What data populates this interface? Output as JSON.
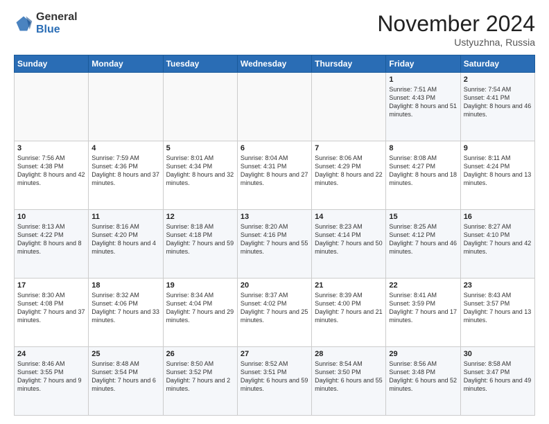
{
  "header": {
    "logo_general": "General",
    "logo_blue": "Blue",
    "month_title": "November 2024",
    "location": "Ustyuzhna, Russia"
  },
  "days_of_week": [
    "Sunday",
    "Monday",
    "Tuesday",
    "Wednesday",
    "Thursday",
    "Friday",
    "Saturday"
  ],
  "weeks": [
    [
      {
        "num": "",
        "info": ""
      },
      {
        "num": "",
        "info": ""
      },
      {
        "num": "",
        "info": ""
      },
      {
        "num": "",
        "info": ""
      },
      {
        "num": "",
        "info": ""
      },
      {
        "num": "1",
        "info": "Sunrise: 7:51 AM\nSunset: 4:43 PM\nDaylight: 8 hours\nand 51 minutes."
      },
      {
        "num": "2",
        "info": "Sunrise: 7:54 AM\nSunset: 4:41 PM\nDaylight: 8 hours\nand 46 minutes."
      }
    ],
    [
      {
        "num": "3",
        "info": "Sunrise: 7:56 AM\nSunset: 4:38 PM\nDaylight: 8 hours\nand 42 minutes."
      },
      {
        "num": "4",
        "info": "Sunrise: 7:59 AM\nSunset: 4:36 PM\nDaylight: 8 hours\nand 37 minutes."
      },
      {
        "num": "5",
        "info": "Sunrise: 8:01 AM\nSunset: 4:34 PM\nDaylight: 8 hours\nand 32 minutes."
      },
      {
        "num": "6",
        "info": "Sunrise: 8:04 AM\nSunset: 4:31 PM\nDaylight: 8 hours\nand 27 minutes."
      },
      {
        "num": "7",
        "info": "Sunrise: 8:06 AM\nSunset: 4:29 PM\nDaylight: 8 hours\nand 22 minutes."
      },
      {
        "num": "8",
        "info": "Sunrise: 8:08 AM\nSunset: 4:27 PM\nDaylight: 8 hours\nand 18 minutes."
      },
      {
        "num": "9",
        "info": "Sunrise: 8:11 AM\nSunset: 4:24 PM\nDaylight: 8 hours\nand 13 minutes."
      }
    ],
    [
      {
        "num": "10",
        "info": "Sunrise: 8:13 AM\nSunset: 4:22 PM\nDaylight: 8 hours\nand 8 minutes."
      },
      {
        "num": "11",
        "info": "Sunrise: 8:16 AM\nSunset: 4:20 PM\nDaylight: 8 hours\nand 4 minutes."
      },
      {
        "num": "12",
        "info": "Sunrise: 8:18 AM\nSunset: 4:18 PM\nDaylight: 7 hours\nand 59 minutes."
      },
      {
        "num": "13",
        "info": "Sunrise: 8:20 AM\nSunset: 4:16 PM\nDaylight: 7 hours\nand 55 minutes."
      },
      {
        "num": "14",
        "info": "Sunrise: 8:23 AM\nSunset: 4:14 PM\nDaylight: 7 hours\nand 50 minutes."
      },
      {
        "num": "15",
        "info": "Sunrise: 8:25 AM\nSunset: 4:12 PM\nDaylight: 7 hours\nand 46 minutes."
      },
      {
        "num": "16",
        "info": "Sunrise: 8:27 AM\nSunset: 4:10 PM\nDaylight: 7 hours\nand 42 minutes."
      }
    ],
    [
      {
        "num": "17",
        "info": "Sunrise: 8:30 AM\nSunset: 4:08 PM\nDaylight: 7 hours\nand 37 minutes."
      },
      {
        "num": "18",
        "info": "Sunrise: 8:32 AM\nSunset: 4:06 PM\nDaylight: 7 hours\nand 33 minutes."
      },
      {
        "num": "19",
        "info": "Sunrise: 8:34 AM\nSunset: 4:04 PM\nDaylight: 7 hours\nand 29 minutes."
      },
      {
        "num": "20",
        "info": "Sunrise: 8:37 AM\nSunset: 4:02 PM\nDaylight: 7 hours\nand 25 minutes."
      },
      {
        "num": "21",
        "info": "Sunrise: 8:39 AM\nSunset: 4:00 PM\nDaylight: 7 hours\nand 21 minutes."
      },
      {
        "num": "22",
        "info": "Sunrise: 8:41 AM\nSunset: 3:59 PM\nDaylight: 7 hours\nand 17 minutes."
      },
      {
        "num": "23",
        "info": "Sunrise: 8:43 AM\nSunset: 3:57 PM\nDaylight: 7 hours\nand 13 minutes."
      }
    ],
    [
      {
        "num": "24",
        "info": "Sunrise: 8:46 AM\nSunset: 3:55 PM\nDaylight: 7 hours\nand 9 minutes."
      },
      {
        "num": "25",
        "info": "Sunrise: 8:48 AM\nSunset: 3:54 PM\nDaylight: 7 hours\nand 6 minutes."
      },
      {
        "num": "26",
        "info": "Sunrise: 8:50 AM\nSunset: 3:52 PM\nDaylight: 7 hours\nand 2 minutes."
      },
      {
        "num": "27",
        "info": "Sunrise: 8:52 AM\nSunset: 3:51 PM\nDaylight: 6 hours\nand 59 minutes."
      },
      {
        "num": "28",
        "info": "Sunrise: 8:54 AM\nSunset: 3:50 PM\nDaylight: 6 hours\nand 55 minutes."
      },
      {
        "num": "29",
        "info": "Sunrise: 8:56 AM\nSunset: 3:48 PM\nDaylight: 6 hours\nand 52 minutes."
      },
      {
        "num": "30",
        "info": "Sunrise: 8:58 AM\nSunset: 3:47 PM\nDaylight: 6 hours\nand 49 minutes."
      }
    ]
  ]
}
